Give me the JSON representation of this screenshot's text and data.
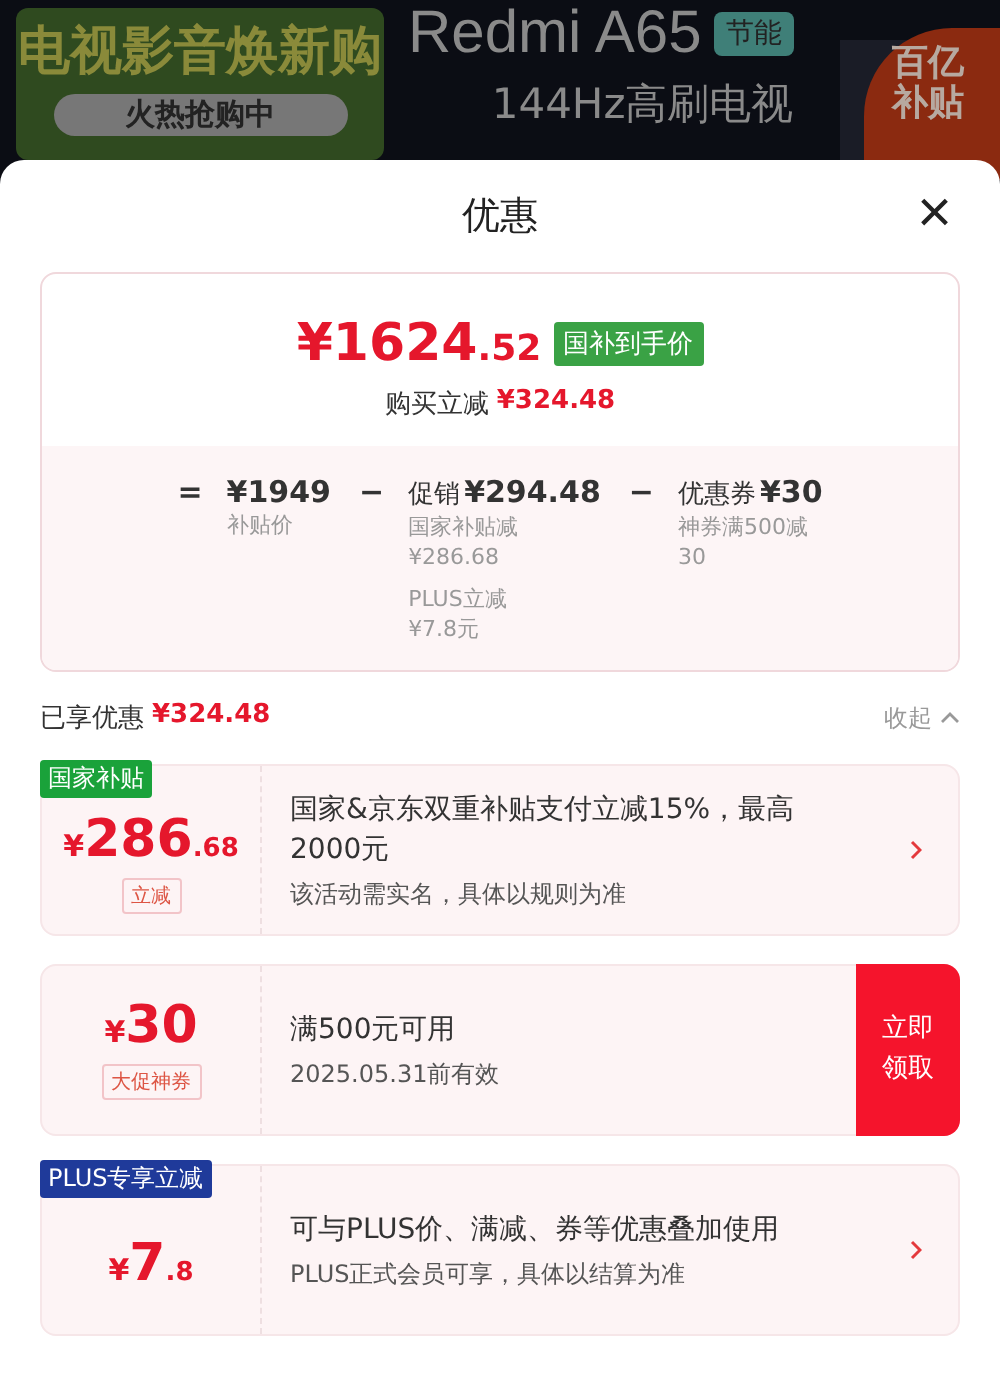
{
  "banner": {
    "left_title": "电视影音焕新购",
    "left_pill": "火热抢购中",
    "product": "Redmi A65",
    "badge": "节能",
    "subtitle": "144Hz高刷电视",
    "corner_badge": [
      "百亿",
      "补贴"
    ]
  },
  "sheet": {
    "title": "优惠",
    "close": "×"
  },
  "summary": {
    "price": "¥1624.52",
    "price_tag": "国补到手价",
    "saving_label": "购买立减",
    "saving": "¥324.48",
    "breakdown": [
      {
        "op": "=",
        "amount": "¥1949",
        "notes": [
          "补贴价"
        ]
      },
      {
        "op": "−",
        "label": "促销",
        "amount": "¥294.48",
        "notes": [
          "国家补贴减",
          "¥286.68",
          "PLUS立减",
          "¥7.8元"
        ]
      },
      {
        "op": "−",
        "label": "优惠券",
        "amount": "¥30",
        "notes": [
          "神券满500减30"
        ]
      }
    ]
  },
  "enjoyed": {
    "label": "已享优惠",
    "amount": "¥324.48",
    "toggle": "收起",
    "expanded": true
  },
  "offers": [
    {
      "kind": "subsidy",
      "tag": "国家补贴",
      "color": "#1aa23a",
      "amount": "¥286.68",
      "sub_label": "立减",
      "lines": [
        "国家&京东双重补贴支付立减15%，最高2000元",
        "该活动需实名，具体以规则为准"
      ]
    },
    {
      "kind": "coupon",
      "amount": "¥30",
      "sub_label": "大促神券",
      "lines": [
        "满500元可用",
        "2025.05.31前有效"
      ],
      "action": "立即领取"
    },
    {
      "kind": "plus",
      "tag": "PLUS专享立减",
      "color": "#1f3a9a",
      "amount": "¥7.8",
      "lines": [
        "可与PLUS价、满减、券等优惠叠加使用",
        "PLUS正式会员可享，具体以结算为准"
      ]
    }
  ]
}
